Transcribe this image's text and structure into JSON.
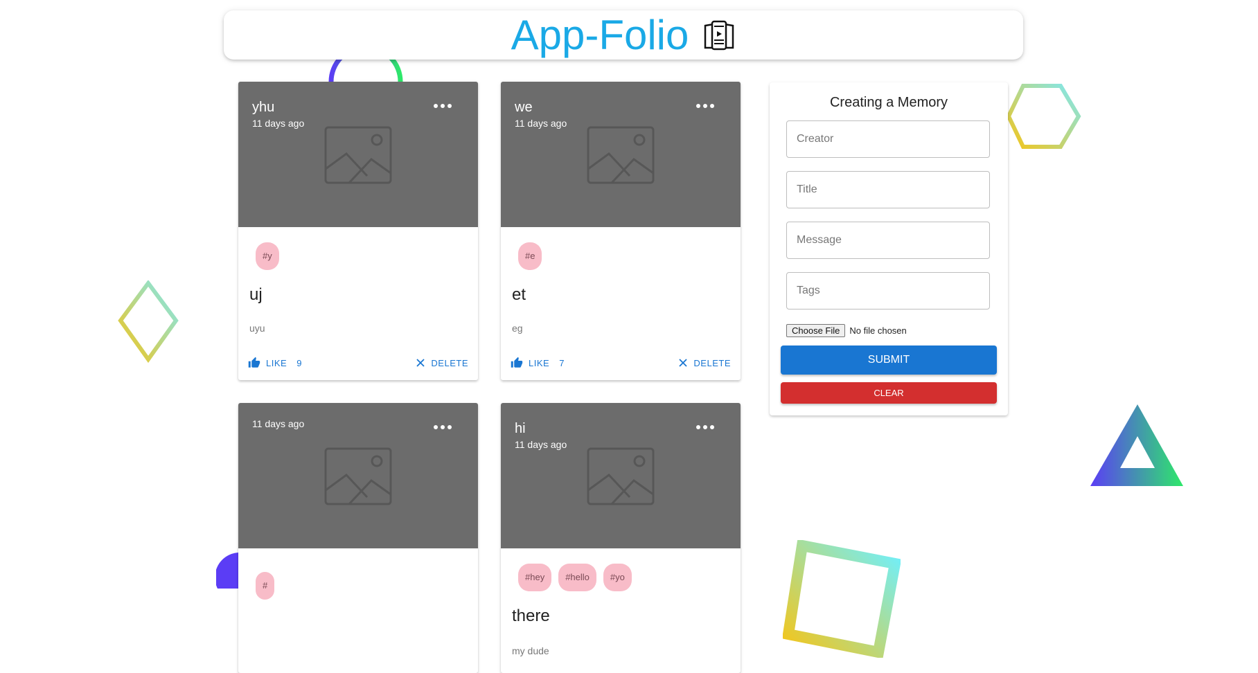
{
  "header": {
    "title": "App-Folio",
    "logo_icon": "book-tablet-icon"
  },
  "posts": [
    {
      "creator": "yhu",
      "time": "11 days ago",
      "tags": [
        "#y"
      ],
      "title": "uj",
      "message": "uyu",
      "like_label": "LIKE",
      "like_count": "9",
      "delete_label": "DELETE"
    },
    {
      "creator": "we",
      "time": "11 days ago",
      "tags": [
        "#e"
      ],
      "title": "et",
      "message": "eg",
      "like_label": "LIKE",
      "like_count": "7",
      "delete_label": "DELETE"
    },
    {
      "creator": "",
      "time": "11 days ago",
      "tags": [
        "#"
      ],
      "title": "",
      "message": ""
    },
    {
      "creator": "hi",
      "time": "11 days ago",
      "tags": [
        "#hey",
        "#hello",
        "#yo"
      ],
      "title": "there",
      "message": "my dude"
    }
  ],
  "form": {
    "title": "Creating a Memory",
    "creator_placeholder": "Creator",
    "title_placeholder": "Title",
    "message_placeholder": "Message",
    "tags_placeholder": "Tags",
    "file_button": "Choose File",
    "file_status": "No file chosen",
    "submit_label": "SUBMIT",
    "clear_label": "CLEAR"
  },
  "colors": {
    "title": "#1aa9e6",
    "card_media": "#6c6c6c",
    "tag": "#f8bcc8",
    "primary": "#1976d2",
    "danger": "#d32f2f"
  }
}
